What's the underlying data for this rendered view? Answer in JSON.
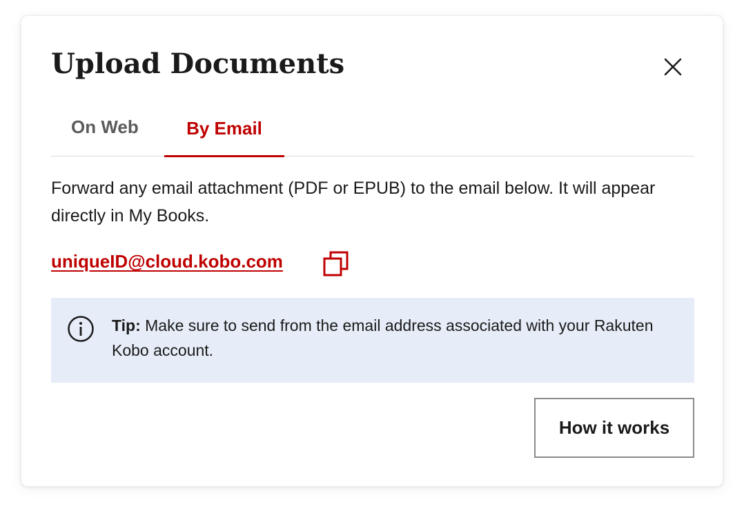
{
  "dialog": {
    "title": "Upload Documents",
    "close_icon": "close-icon"
  },
  "tabs": [
    {
      "label": "On Web",
      "active": false
    },
    {
      "label": "By Email",
      "active": true
    }
  ],
  "content": {
    "description": "Forward any email attachment (PDF or EPUB) to the email below. It will appear directly in My Books.",
    "email": "uniqueID@cloud.kobo.com",
    "copy_icon": "copy-icon"
  },
  "tip": {
    "icon": "info-icon",
    "label": "Tip:",
    "text": " Make sure to send from the email address associated with your Rakuten Kobo account."
  },
  "actions": {
    "how_it_works_label": "How it works"
  },
  "colors": {
    "accent": "#bf0000",
    "tip_background": "#e6edf8",
    "text": "#1a1a1a",
    "inactive_tab": "#5b5b5b"
  }
}
